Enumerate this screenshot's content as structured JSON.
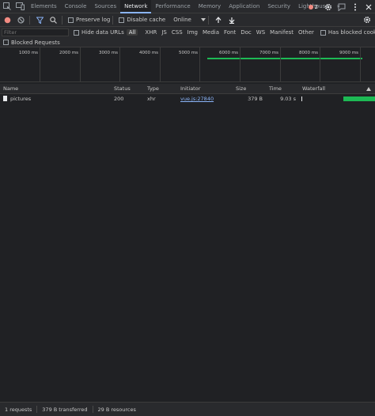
{
  "tabs": [
    {
      "label": "Elements"
    },
    {
      "label": "Console"
    },
    {
      "label": "Sources"
    },
    {
      "label": "Network"
    },
    {
      "label": "Performance"
    },
    {
      "label": "Memory"
    },
    {
      "label": "Application"
    },
    {
      "label": "Security"
    },
    {
      "label": "Lighthouse"
    }
  ],
  "tab_overflow": "»",
  "error_count": "2",
  "toolbar": {
    "preserve_log": "Preserve log",
    "disable_cache": "Disable cache",
    "throttling": "Online"
  },
  "filter": {
    "placeholder": "Filter",
    "hide_data_urls": "Hide data URLs",
    "types": [
      "All",
      "XHR",
      "JS",
      "CSS",
      "Img",
      "Media",
      "Font",
      "Doc",
      "WS",
      "Manifest",
      "Other"
    ],
    "has_blocked_cookies": "Has blocked cookies",
    "blocked_requests": "Blocked Requests"
  },
  "overview": {
    "ticks": [
      "1000 ms",
      "2000 ms",
      "3000 ms",
      "4000 ms",
      "5000 ms",
      "6000 ms",
      "7000 ms",
      "8000 ms",
      "9000 ms"
    ]
  },
  "columns": {
    "name": "Name",
    "status": "Status",
    "type": "Type",
    "initiator": "Initiator",
    "size": "Size",
    "time": "Time",
    "waterfall": "Waterfall"
  },
  "requests": [
    {
      "name": "pictures",
      "status": "200",
      "type": "xhr",
      "initiator": "vue.js:27840",
      "size": "379 B",
      "time": "9.03 s"
    }
  ],
  "status_bar": {
    "requests": "1 requests",
    "transferred": "379 B transferred",
    "resources": "29 B resources"
  },
  "colors": {
    "accent": "#8ab4f8",
    "bar": "#1db954",
    "error": "#f28b82"
  }
}
